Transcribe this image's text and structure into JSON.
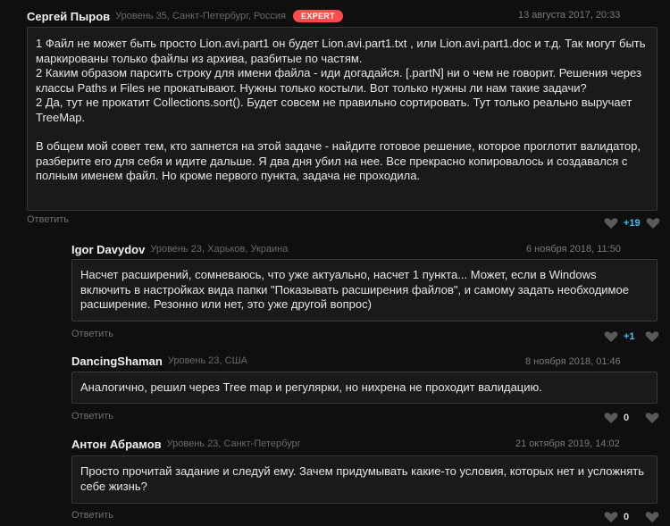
{
  "colors": {
    "background": "#0f0f0f",
    "panel": "#1a1a1a",
    "border": "#3a3a3a",
    "expert_badge": "#ff4b4b",
    "positive_score": "#3fc3ff"
  },
  "comments": [
    {
      "author": "Сергей Пыров",
      "meta": "Уровень 35, Санкт-Петербург, Россия",
      "badge": "EXPERT",
      "date": "13 августа 2017, 20:33",
      "lines": [
        "1 Файл не может быть просто Lion.avi.part1 он будет Lion.avi.part1.txt , или Lion.avi.part1.doc и т.д. Так могут быть маркированы только файлы из архива, разбитые по частям.",
        "2 Каким образом парсить строку для имени файла - иди догадайся. [.partN] ни о чем не говорит. Решения через классы Paths и Files не прокатывают. Нужны только костыли. Вот только нужны ли нам такие задачи?",
        "2 Да, тут не прокатит Collections.sort(). Будет совсем не правильно сортировать. Тут только реально выручает TreeMap.",
        "В общем мой совет тем, кто запнется на этой задаче - найдите готовое решение, которое проглотит валидатор, разберите его для себя и идите дальше. Я два дня убил на нее. Все прекрасно копировалось и создавался с полным именем файл. Но кроме первого пункта, задача не проходила."
      ],
      "reply_label": "Ответить",
      "score": "+19"
    },
    {
      "author": "Igor Davydov",
      "meta": "Уровень 23, Харьков, Украина",
      "date": "6 ноября 2018, 11:50",
      "lines": [
        "Насчет расширений, сомневаюсь, что уже актуально, насчет 1 пункта... Может, если в Windows включить в настройках вида папки \"Показывать расширения файлов\", и самому задать необходимое расширение. Резонно или нет, это уже другой вопрос)"
      ],
      "reply_label": "Ответить",
      "score": "+1"
    },
    {
      "author": "DancingShaman",
      "meta": "Уровень 23, США",
      "date": "8 ноября 2018, 01:46",
      "lines": [
        "Аналогично, решил через Tree map и регулярки, но нихрена не проходит валидацию."
      ],
      "reply_label": "Ответить",
      "score": "0"
    },
    {
      "author": "Антон Абрамов",
      "meta": "Уровень 23, Санкт-Петербург",
      "date": "21 октября 2019, 14:02",
      "lines": [
        "Просто прочитай задание и следуй ему. Зачем придумывать какие-то условия, которых нет и усложнять себе жизнь?"
      ],
      "reply_label": "Ответить",
      "score": "0"
    }
  ]
}
